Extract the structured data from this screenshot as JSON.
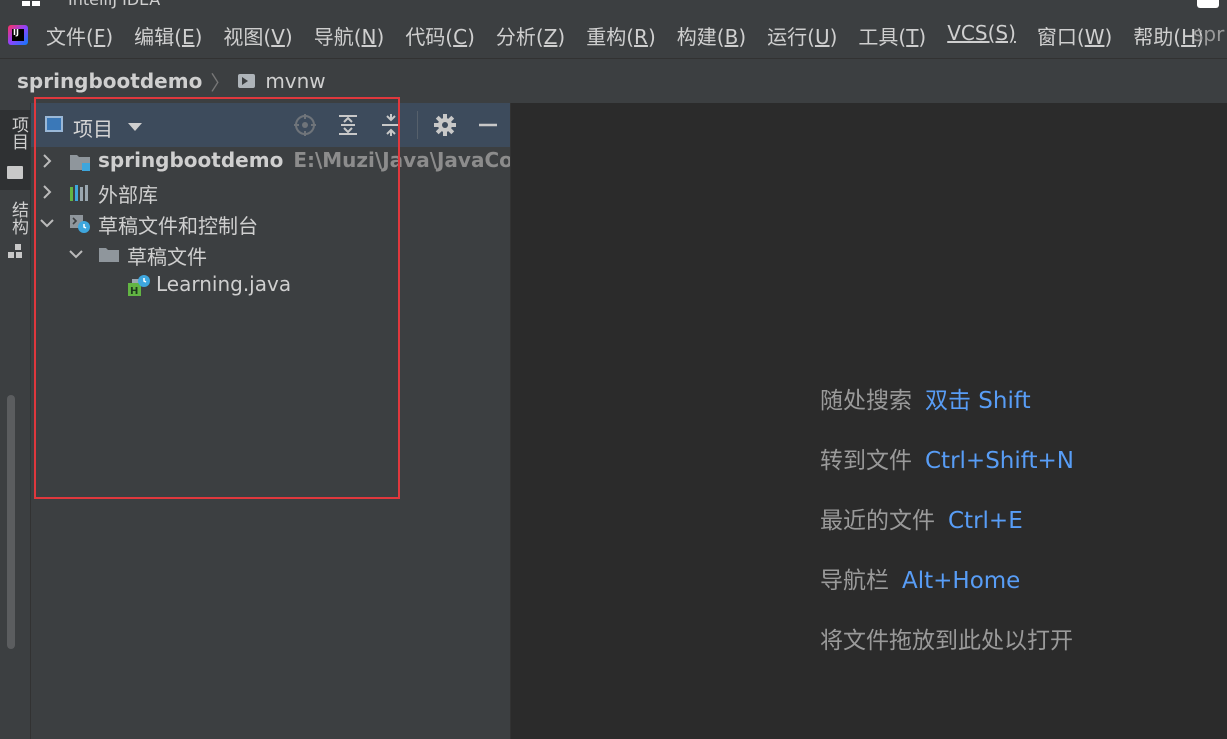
{
  "window": {
    "title": "IntelliJ IDEA"
  },
  "menu": {
    "items": [
      {
        "label": "文件(",
        "mnemonic": "F",
        "end": ")"
      },
      {
        "label": "编辑(",
        "mnemonic": "E",
        "end": ")"
      },
      {
        "label": "视图(",
        "mnemonic": "V",
        "end": ")"
      },
      {
        "label": "导航(",
        "mnemonic": "N",
        "end": ")"
      },
      {
        "label": "代码(",
        "mnemonic": "C",
        "end": ")"
      },
      {
        "label": "分析(",
        "mnemonic": "Z",
        "end": ")"
      },
      {
        "label": "重构(",
        "mnemonic": "R",
        "end": ")"
      },
      {
        "label": "构建(",
        "mnemonic": "B",
        "end": ")"
      },
      {
        "label": "运行(",
        "mnemonic": "U",
        "end": ")"
      },
      {
        "label": "工具(",
        "mnemonic": "T",
        "end": ")"
      },
      {
        "label": "",
        "mnemonic": "VCS(S)",
        "end": ""
      },
      {
        "label": "窗口(",
        "mnemonic": "W",
        "end": ")"
      },
      {
        "label": "帮助(",
        "mnemonic": "H",
        "end": ")"
      }
    ],
    "right_text": "spr"
  },
  "breadcrumb": {
    "project": "springbootdemo",
    "separator": "〉",
    "file": "mvnw"
  },
  "tool_strip": {
    "project_label": "项目",
    "structure_label": "结构"
  },
  "project_panel": {
    "view_label": "项目",
    "tree": [
      {
        "label": "springbootdemo",
        "path": "E:\\Muzi\\Java\\JavaCode\\s",
        "expanded": false,
        "bold": true,
        "icon": "module-folder-icon"
      },
      {
        "label": "外部库",
        "path": "",
        "expanded": false,
        "bold": false,
        "icon": "library-icon"
      },
      {
        "label": "草稿文件和控制台",
        "path": "",
        "expanded": true,
        "bold": false,
        "icon": "scratches-icon"
      },
      {
        "label": "草稿文件",
        "path": "",
        "expanded": true,
        "bold": false,
        "icon": "folder-icon"
      },
      {
        "label": "Learning.java",
        "path": "",
        "expanded": null,
        "bold": false,
        "icon": "scratch-java-file-icon"
      }
    ]
  },
  "editor_hints": [
    {
      "text": "随处搜索",
      "key": "双击 Shift"
    },
    {
      "text": "转到文件",
      "key": "Ctrl+Shift+N"
    },
    {
      "text": "最近的文件",
      "key": "Ctrl+E"
    },
    {
      "text": "导航栏",
      "key": "Alt+Home"
    },
    {
      "text": "将文件拖放到此处以打开",
      "key": ""
    }
  ],
  "colors": {
    "accent_key": "#589df6",
    "highlight_box": "#e0383d",
    "panel_header": "#3d4b5c"
  }
}
